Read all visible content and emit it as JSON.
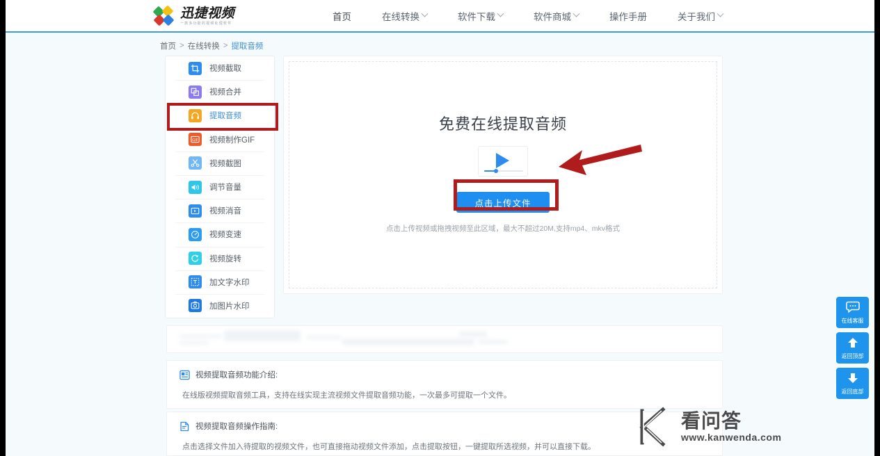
{
  "header": {
    "logo_name": "迅捷视频",
    "logo_sub": "一款多功能的视频处理软件",
    "nav": [
      {
        "label": "首页",
        "has_caret": false
      },
      {
        "label": "在线转换",
        "has_caret": true
      },
      {
        "label": "软件下载",
        "has_caret": true
      },
      {
        "label": "软件商城",
        "has_caret": true
      },
      {
        "label": "操作手册",
        "has_caret": false
      },
      {
        "label": "关于我们",
        "has_caret": true
      }
    ]
  },
  "breadcrumb": {
    "items": [
      "首页",
      "在线转换",
      "提取音频"
    ],
    "separator": ">"
  },
  "sidebar": {
    "items": [
      {
        "label": "视频截取",
        "icon": "crop-icon",
        "color": "#2d8cf0",
        "active": false
      },
      {
        "label": "视频合并",
        "icon": "merge-icon",
        "color": "#8a7cf0",
        "active": false
      },
      {
        "label": "提取音频",
        "icon": "headphone-icon",
        "color": "#f5a623",
        "active": true
      },
      {
        "label": "视频制作GIF",
        "icon": "gif-icon",
        "color": "#f05a28",
        "active": false
      },
      {
        "label": "视频截图",
        "icon": "scissors-icon",
        "color": "#6fb8f5",
        "active": false
      },
      {
        "label": "调节音量",
        "icon": "volume-icon",
        "color": "#2ec6e8",
        "active": false
      },
      {
        "label": "视频消音",
        "icon": "mute-icon",
        "color": "#2d8cf0",
        "active": false
      },
      {
        "label": "视频变速",
        "icon": "speed-icon",
        "color": "#2d9cf0",
        "active": false
      },
      {
        "label": "视频旋转",
        "icon": "rotate-icon",
        "color": "#2ed0e8",
        "active": false
      },
      {
        "label": "加文字水印",
        "icon": "text-mark-icon",
        "color": "#2d8cf0",
        "active": false
      },
      {
        "label": "加图片水印",
        "icon": "image-mark-icon",
        "color": "#1f7ae0",
        "active": false
      }
    ]
  },
  "upload": {
    "title": "免费在线提取音频",
    "button_label": "点击上传文件",
    "hint": "点击上传视频或拖拽视频至此区域，最大不超过20M,支持mp4、mkv格式",
    "play_icon": "video-play-icon",
    "button_color": "#1e8ef1",
    "annotation_color": "#b01c1c"
  },
  "info_sections": [
    {
      "icon": "doc-info-icon",
      "title": "视频提取音频功能介绍:",
      "body": "在线版视频提取音频工具，支持在线实现主流视频文件提取音频功能，一次最多可提取一个文件。"
    },
    {
      "icon": "guide-icon",
      "title": "视频提取音频操作指南:",
      "body": "点击选择文件加入待提取的视频文件，也可直接拖动视频文件添加，点击提取按钮，一键提取所选视频，并可以直接下载。"
    }
  ],
  "float_widgets": [
    {
      "label": "在线客服",
      "icon": "chat-bubble-icon"
    },
    {
      "label": "返回顶部",
      "icon": "arrow-up-icon"
    },
    {
      "label": "返回底部",
      "icon": "arrow-down-icon"
    }
  ],
  "watermark": {
    "cn": "看问答",
    "url": "www.kanwenda.com",
    "logo": "k-logo-icon"
  }
}
